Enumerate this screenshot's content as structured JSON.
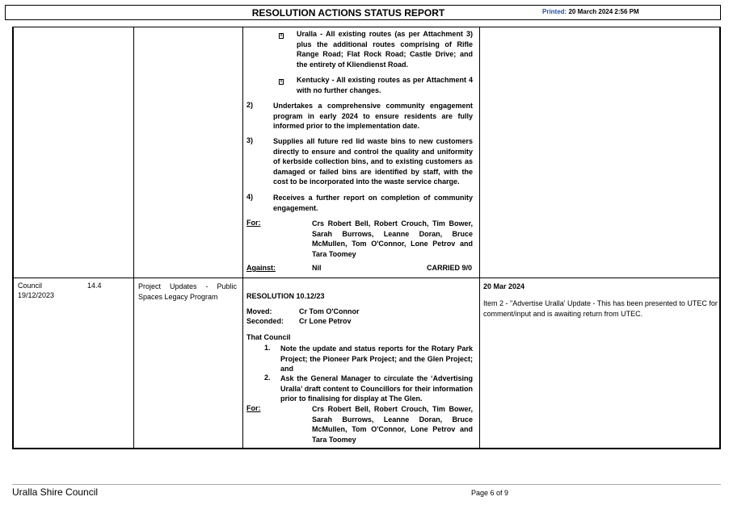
{
  "header": {
    "title": "RESOLUTION ACTIONS STATUS REPORT",
    "printed_label": "Printed:",
    "printed_value": "20 March 2024 2:56 PM"
  },
  "row1": {
    "bullets": [
      "Uralla - All existing routes (as per Attachment 3) plus the additional routes comprising of Rifle Range Road; Flat Rock Road; Castle Drive; and the entirety of Kliendienst Road.",
      "Kentucky - All existing routes as per Attachment 4 with no further changes."
    ],
    "items": [
      {
        "num": "2)",
        "text": "Undertakes a comprehensive community engagement program in early 2024 to ensure residents are fully informed prior to the implementation date."
      },
      {
        "num": "3)",
        "text": "Supplies all future red lid waste bins to new customers directly to ensure and control the quality and uniformity of kerbside collection bins, and to existing customers as damaged or failed bins are identified by staff, with the cost to be incorporated into the waste service charge."
      },
      {
        "num": "4)",
        "text": "Receives a further report on completion of community engagement."
      }
    ],
    "for_label": "For:",
    "for_text": "Crs Robert Bell, Robert Crouch, Tim Bower, Sarah Burrows, Leanne Doran, Bruce McMullen, Tom O'Connor, Lone Petrov and Tara Toomey",
    "against_label": "Against:",
    "against_value": "Nil",
    "carried": "CARRIED 9/0"
  },
  "row2": {
    "meeting": "Council",
    "date": "19/12/2023",
    "item_no": "14.4",
    "subject": "Project Updates - Public Spaces Legacy Program",
    "resolution": "RESOLUTION 10.12/23",
    "moved_label": "Moved:",
    "moved_value": "Cr Tom O'Connor",
    "seconded_label": "Seconded:",
    "seconded_value": "Cr Lone Petrov",
    "that_council": "That Council",
    "items": [
      {
        "num": "1.",
        "text": "Note the update and status reports for the Rotary Park Project; the Pioneer Park Project; and the Glen Project; and"
      },
      {
        "num": "2.",
        "text": "Ask the General Manager to circulate the ‘Advertising Uralla’ draft content to Councillors for their information prior to finalising for display at The Glen."
      }
    ],
    "for_label": "For:",
    "for_text": "Crs Robert Bell, Robert Crouch, Tim Bower, Sarah Burrows, Leanne Doran, Bruce McMullen, Tom O'Connor, Lone Petrov and Tara Toomey",
    "status_date": "20 Mar 2024",
    "status_text": "Item 2 - \"Advertise Uralla' Update - This has been presented to UTEC for comment/input and is awaiting return from UTEC."
  },
  "footer": {
    "org": "Uralla Shire Council",
    "page": "Page 6 of 9"
  }
}
